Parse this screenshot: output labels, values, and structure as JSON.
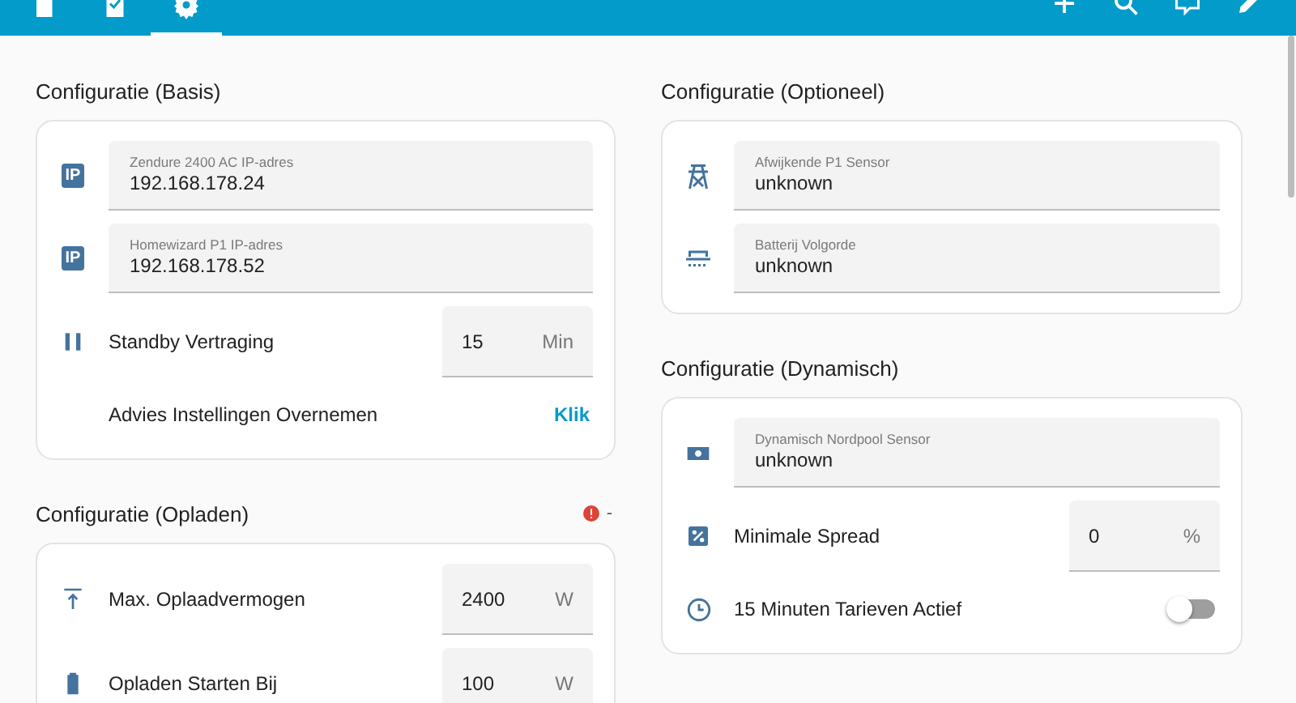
{
  "toolbar": {
    "tabs": [
      {
        "kind": "page",
        "selected": false
      },
      {
        "kind": "clipboard",
        "selected": false
      },
      {
        "kind": "settings",
        "selected": true
      }
    ]
  },
  "columns": [
    {
      "sections": [
        {
          "title": "Configuratie (Basis)",
          "rows": [
            {
              "kind": "text_field",
              "badge": "IP",
              "label": "Zendure 2400 AC IP-adres",
              "value": "192.168.178.24"
            },
            {
              "kind": "text_field",
              "badge": "IP",
              "label": "Homewizard P1 IP-adres",
              "value": "192.168.178.52"
            },
            {
              "kind": "number",
              "label": "Standby Vertraging",
              "value": "15",
              "unit": "Min"
            },
            {
              "kind": "button",
              "label": "Advies Instellingen Overnemen",
              "action": "Klik"
            }
          ]
        },
        {
          "title": "Configuratie (Opladen)",
          "status": "-",
          "rows": [
            {
              "kind": "number",
              "label": "Max. Oplaadvermogen",
              "value": "2400",
              "unit": "W"
            },
            {
              "kind": "number",
              "label": "Opladen Starten Bij",
              "value": "100",
              "unit": "W"
            }
          ]
        }
      ]
    },
    {
      "sections": [
        {
          "title": "Configuratie (Optioneel)",
          "rows": [
            {
              "kind": "text_field",
              "label": "Afwijkende P1 Sensor",
              "value": "unknown"
            },
            {
              "kind": "text_field",
              "label": "Batterij Volgorde",
              "value": "unknown"
            }
          ]
        },
        {
          "title": "Configuratie (Dynamisch)",
          "rows": [
            {
              "kind": "text_field",
              "label": "Dynamisch Nordpool Sensor",
              "value": "unknown"
            },
            {
              "kind": "number",
              "label": "Minimale Spread",
              "value": "0",
              "unit": "%"
            },
            {
              "kind": "toggle",
              "label": "15 Minuten Tarieven Actief",
              "on": false
            }
          ]
        }
      ]
    }
  ]
}
